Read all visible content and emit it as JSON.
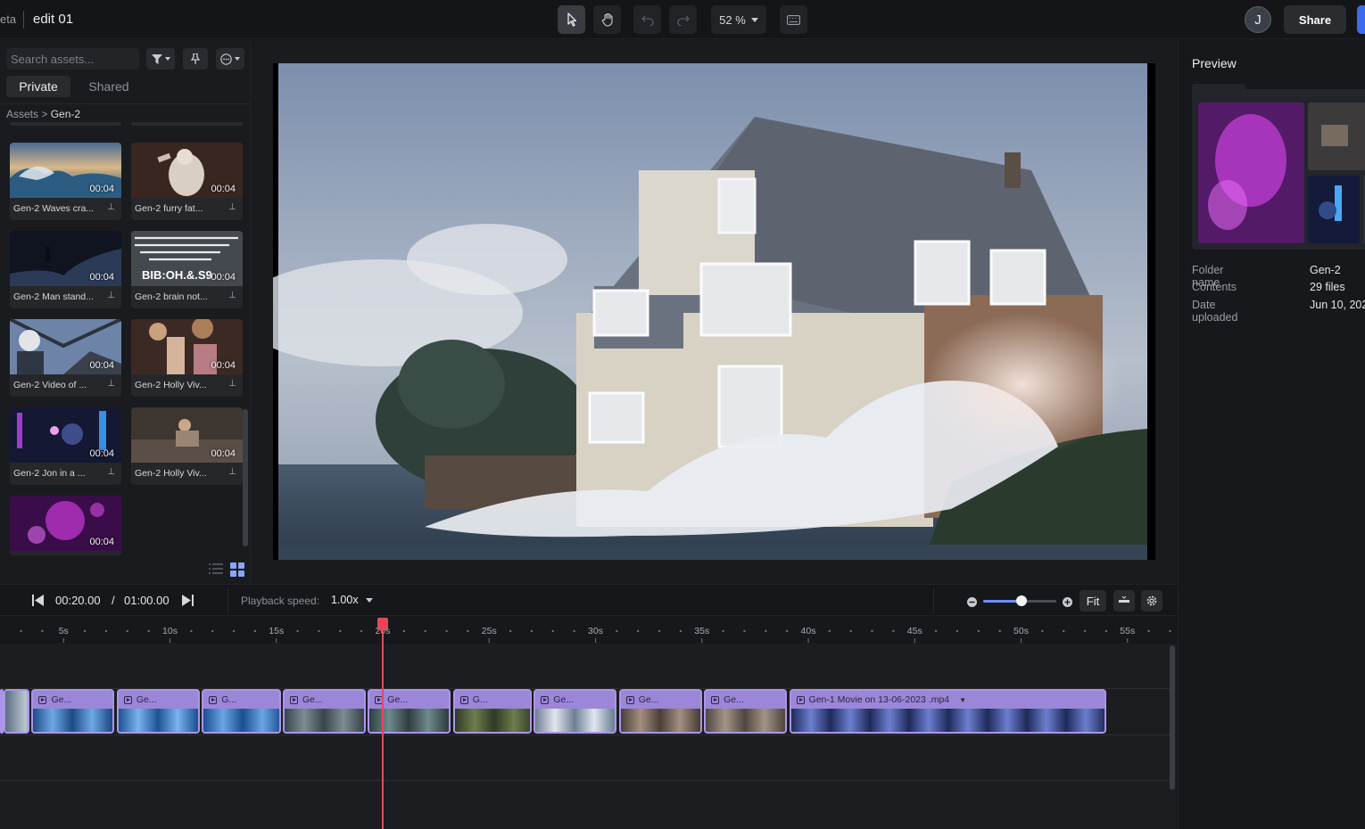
{
  "app": {
    "beta_label": "eta",
    "project_title": "edit 01"
  },
  "toolbar": {
    "zoom": "52 %",
    "avatar_initial": "J",
    "share_label": "Share"
  },
  "assets": {
    "search_placeholder": "Search assets...",
    "tabs": [
      "Private",
      "Shared"
    ],
    "breadcrumb_root": "Assets",
    "breadcrumb_sep": ">",
    "breadcrumb_current": "Gen-2",
    "items": [
      {
        "name": "Gen-2 Waves cra...",
        "duration": "00:04"
      },
      {
        "name": "Gen-2 furry fat...",
        "duration": "00:04"
      },
      {
        "name": "Gen-2 Man stand...",
        "duration": "00:04"
      },
      {
        "name": "Gen-2 brain not...",
        "duration": "00:04",
        "thumb_text": "BIB:OH.&.S9"
      },
      {
        "name": "Gen-2 Video of ...",
        "duration": "00:04"
      },
      {
        "name": "Gen-2 Holly Viv...",
        "duration": "00:04"
      },
      {
        "name": "Gen-2 Jon in a ...",
        "duration": "00:04"
      },
      {
        "name": "Gen-2 Holly Viv...",
        "duration": "00:04"
      },
      {
        "name": "",
        "duration": "00:04"
      }
    ]
  },
  "preview": {
    "title": "Preview",
    "folder_name_label": "Folder name",
    "folder_name": "Gen-2",
    "contents_label": "Contents",
    "contents": "29 files",
    "date_label": "Date uploaded",
    "date": "Jun 10, 202"
  },
  "transport": {
    "current_time": "00:20.00",
    "separator": "/",
    "total_time": "01:00.00",
    "speed_label": "Playback speed:",
    "speed_value": "1.00x",
    "zoom_level": 0.52,
    "fit_label": "Fit"
  },
  "timeline": {
    "ruler_labels": [
      "5s",
      "10s",
      "15s",
      "20s",
      "25s",
      "30s",
      "35s",
      "40s",
      "45s",
      "50s",
      "55s"
    ],
    "playhead_time_s": 20,
    "clips": [
      {
        "label": "",
        "start": 0,
        "end": 2.1
      },
      {
        "label": "",
        "start": 2.2,
        "end": 3.4
      },
      {
        "label": "Ge...",
        "start": 3.5,
        "end": 7.4
      },
      {
        "label": "Ge...",
        "start": 7.5,
        "end": 11.4
      },
      {
        "label": "G...",
        "start": 11.5,
        "end": 15.2
      },
      {
        "label": "Ge...",
        "start": 15.3,
        "end": 19.2
      },
      {
        "label": "Ge...",
        "start": 19.3,
        "end": 23.2
      },
      {
        "label": "G...",
        "start": 23.3,
        "end": 27.0
      },
      {
        "label": "Ge...",
        "start": 27.1,
        "end": 31.0
      },
      {
        "label": "Ge...",
        "start": 31.1,
        "end": 35.0
      },
      {
        "label": "Ge...",
        "start": 35.1,
        "end": 39.0
      },
      {
        "label": "Gen-1 Movie on 13-06-2023 .mp4",
        "start": 39.1,
        "end": 54.0
      }
    ]
  },
  "colors": {
    "accent_blue": "#3b6cf0",
    "clip_purple": "#9b86d8",
    "playhead_red": "#e8475b",
    "slider_blue": "#6f8ff5"
  }
}
